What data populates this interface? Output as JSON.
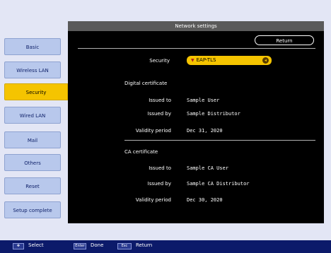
{
  "window": {
    "title": "Network settings"
  },
  "sidebar": {
    "items": [
      {
        "label": "Basic"
      },
      {
        "label": "Wireless LAN"
      },
      {
        "label": "Security"
      },
      {
        "label": "Wired LAN"
      },
      {
        "label": "Mail"
      },
      {
        "label": "Others"
      },
      {
        "label": "Reset"
      },
      {
        "label": "Setup complete"
      }
    ]
  },
  "main": {
    "return_label": "Return",
    "security_label": "Security",
    "security_value": "EAP-TLS",
    "digital_cert": {
      "heading": "Digital certificate",
      "issued_to_label": "Issued to",
      "issued_to_value": "Sample User",
      "issued_by_label": "Issued by",
      "issued_by_value": "Sample Distributor",
      "validity_label": "Validity period",
      "validity_value": "Dec 31, 2020"
    },
    "ca_cert": {
      "heading": "CA certificate",
      "issued_to_label": "Issued to",
      "issued_to_value": "Sample CA User",
      "issued_by_label": "Issued by",
      "issued_by_value": "Sample CA Distributor",
      "validity_label": "Validity period",
      "validity_value": "Dec 30, 2020"
    }
  },
  "footer": {
    "select_label": "Select",
    "enter_key": "Enter",
    "done_label": "Done",
    "esc_key": "Esc",
    "return_label": "Return"
  },
  "colors": {
    "accent": "#f5c400",
    "panel_bg": "#000000",
    "sidebar_bg": "#b8c8ec",
    "footer_bg": "#0c1a6a"
  }
}
